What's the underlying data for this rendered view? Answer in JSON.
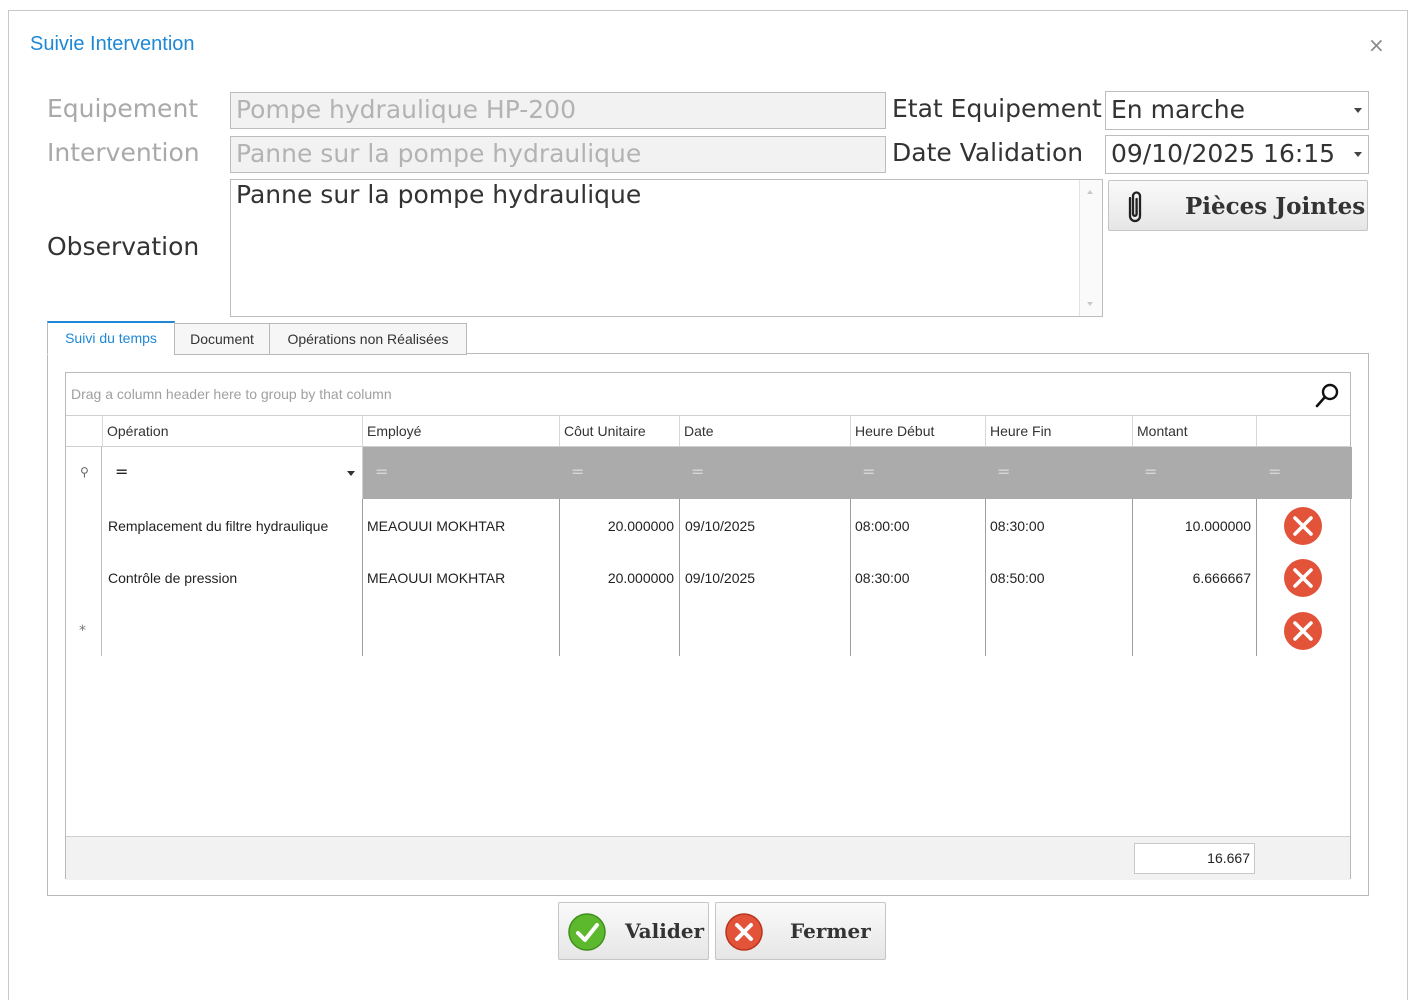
{
  "window": {
    "title": "Suivie Intervention",
    "close_symbol": "×"
  },
  "form": {
    "equipement_label": "Equipement",
    "equipement_value": "Pompe hydraulique HP-200",
    "intervention_label": "Intervention",
    "intervention_value": "Panne sur la pompe hydraulique",
    "observation_label": "Observation",
    "observation_value": "Panne sur la pompe hydraulique",
    "etat_label": "Etat Equipement",
    "etat_value": "En marche",
    "date_validation_label": "Date Validation",
    "date_validation_value": "09/10/2025 16:15",
    "attach_label": "Pièces Jointes"
  },
  "tabs": [
    {
      "label": "Suivi du temps",
      "active": true
    },
    {
      "label": "Document",
      "active": false
    },
    {
      "label": "Opérations non Réalisées",
      "active": false
    }
  ],
  "grid": {
    "group_panel_text": "Drag a column header here to group by that column",
    "columns": [
      "Opération",
      "Employé",
      "Côut Unitaire",
      "Date",
      "Heure Début",
      "Heure Fin",
      "Montant"
    ],
    "filter_symbol": "=",
    "rows": [
      {
        "operation": "Remplacement du filtre hydraulique",
        "employe": "MEAOUUI MOKHTAR",
        "cout": "20.000000",
        "date": "09/10/2025",
        "debut": "08:00:00",
        "fin": "08:30:00",
        "montant": "10.000000"
      },
      {
        "operation": "Contrôle de pression",
        "employe": "MEAOUUI MOKHTAR",
        "cout": "20.000000",
        "date": "09/10/2025",
        "debut": "08:30:00",
        "fin": "08:50:00",
        "montant": "6.666667"
      }
    ],
    "new_row_symbol": "*",
    "footer_total": "16.667"
  },
  "buttons": {
    "valider": "Valider",
    "fermer": "Fermer"
  },
  "colors": {
    "accent": "#1e88d6",
    "delete": "#e2533a",
    "ok": "#5cb82c"
  }
}
